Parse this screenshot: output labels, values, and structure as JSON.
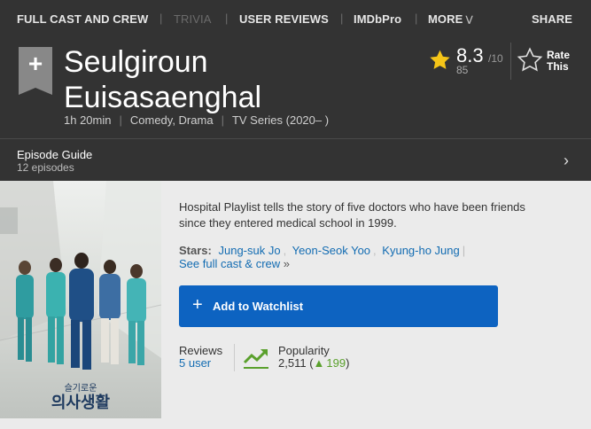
{
  "subnav": {
    "full_cast": "FULL CAST AND CREW",
    "trivia": "TRIVIA",
    "user_reviews": "USER REVIEWS",
    "imdbpro": "IMDbPro",
    "more": "MORE",
    "share": "SHARE"
  },
  "title": {
    "line1": "Seulgiroun",
    "line2": "Euisasaenghal"
  },
  "meta": {
    "runtime": "1h 20min",
    "genres": "Comedy, Drama",
    "type": "TV Series (2020– )"
  },
  "rating": {
    "value": "8.3",
    "out_of": "/10",
    "count": "85",
    "star_color": "#f5c518"
  },
  "rate_this": {
    "label_line1": "Rate",
    "label_line2": "This"
  },
  "episode_guide": {
    "title": "Episode Guide",
    "count": "12 episodes"
  },
  "plot": "Hospital Playlist tells the story of five doctors who have been friends since they entered medical school in 1999.",
  "stars": {
    "label": "Stars:",
    "names": [
      "Jung-suk Jo",
      "Yeon-Seok Yoo",
      "Kyung-ho Jung"
    ],
    "see_all": "See full cast & crew"
  },
  "watchlist": {
    "label": "Add to Watchlist",
    "color": "#0d63c1"
  },
  "reviews": {
    "label": "Reviews",
    "count": "5 user"
  },
  "popularity": {
    "label": "Popularity",
    "rank": "2,511",
    "change": "199",
    "icon_color": "#5aa02c"
  },
  "poster": {
    "poster_title": "슬기로운 의사생활"
  },
  "icons": [
    "add-icon",
    "star-icon",
    "star-outline-icon",
    "chevron-right-icon",
    "chevron-down-icon",
    "plus-icon",
    "popularity-trend-icon",
    "up-arrow-icon"
  ]
}
